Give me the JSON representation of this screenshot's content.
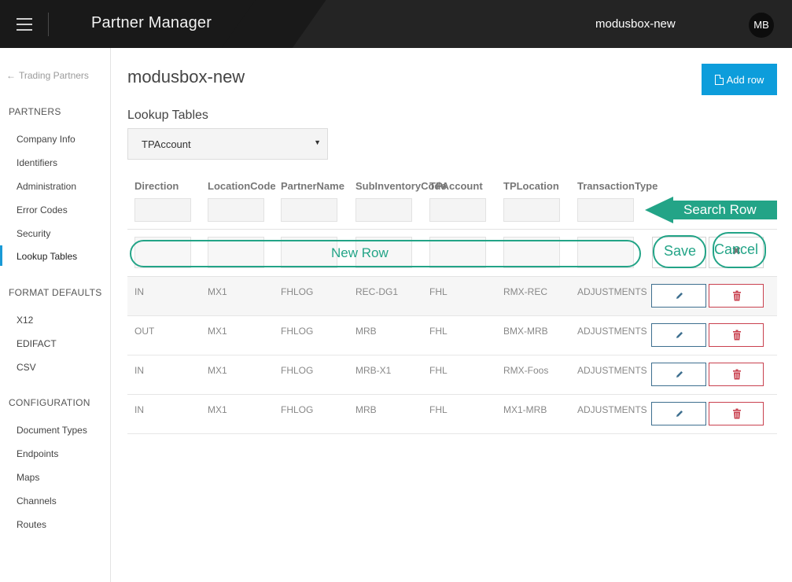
{
  "app": {
    "title": "Partner Manager",
    "org": "modusbox-new",
    "avatar_initials": "MB"
  },
  "sidebar": {
    "back_label": "Trading Partners",
    "sections": [
      {
        "heading": "PARTNERS",
        "items": [
          "Company Info",
          "Identifiers",
          "Administration",
          "Error Codes",
          "Security",
          "Lookup Tables"
        ]
      },
      {
        "heading": "FORMAT DEFAULTS",
        "items": [
          "X12",
          "EDIFACT",
          "CSV"
        ]
      },
      {
        "heading": "CONFIGURATION",
        "items": [
          "Document Types",
          "Endpoints",
          "Maps",
          "Channels",
          "Routes"
        ]
      }
    ],
    "active_item": "Lookup Tables"
  },
  "main": {
    "title": "modusbox-new",
    "add_row_label": "Add row",
    "lookup_label": "Lookup Tables",
    "lookup_selected": "TPAccount",
    "columns": [
      "Direction",
      "LocationCode",
      "PartnerName",
      "SubInventoryCode",
      "TPAccount",
      "TPLocation",
      "TransactionType"
    ],
    "rows": [
      [
        "IN",
        "MX1",
        "FHLOG",
        "REC-DG1",
        "FHL",
        "RMX-REC",
        "ADJUSTMENTS"
      ],
      [
        "OUT",
        "MX1",
        "FHLOG",
        "MRB",
        "FHL",
        "BMX-MRB",
        "ADJUSTMENTS"
      ],
      [
        "IN",
        "MX1",
        "FHLOG",
        "MRB-X1",
        "FHL",
        "RMX-Foos",
        "ADJUSTMENTS"
      ],
      [
        "IN",
        "MX1",
        "FHLOG",
        "MRB",
        "FHL",
        "MX1-MRB",
        "ADJUSTMENTS"
      ]
    ]
  },
  "annotations": {
    "search_row": "Search Row",
    "new_row": "New Row",
    "save": "Save",
    "cancel": "Cancel"
  },
  "colors": {
    "topbar": "#242424",
    "accent": "#0d9ddb",
    "annotation": "#23a487",
    "edit": "#3e6f8f",
    "delete": "#c9414f"
  }
}
